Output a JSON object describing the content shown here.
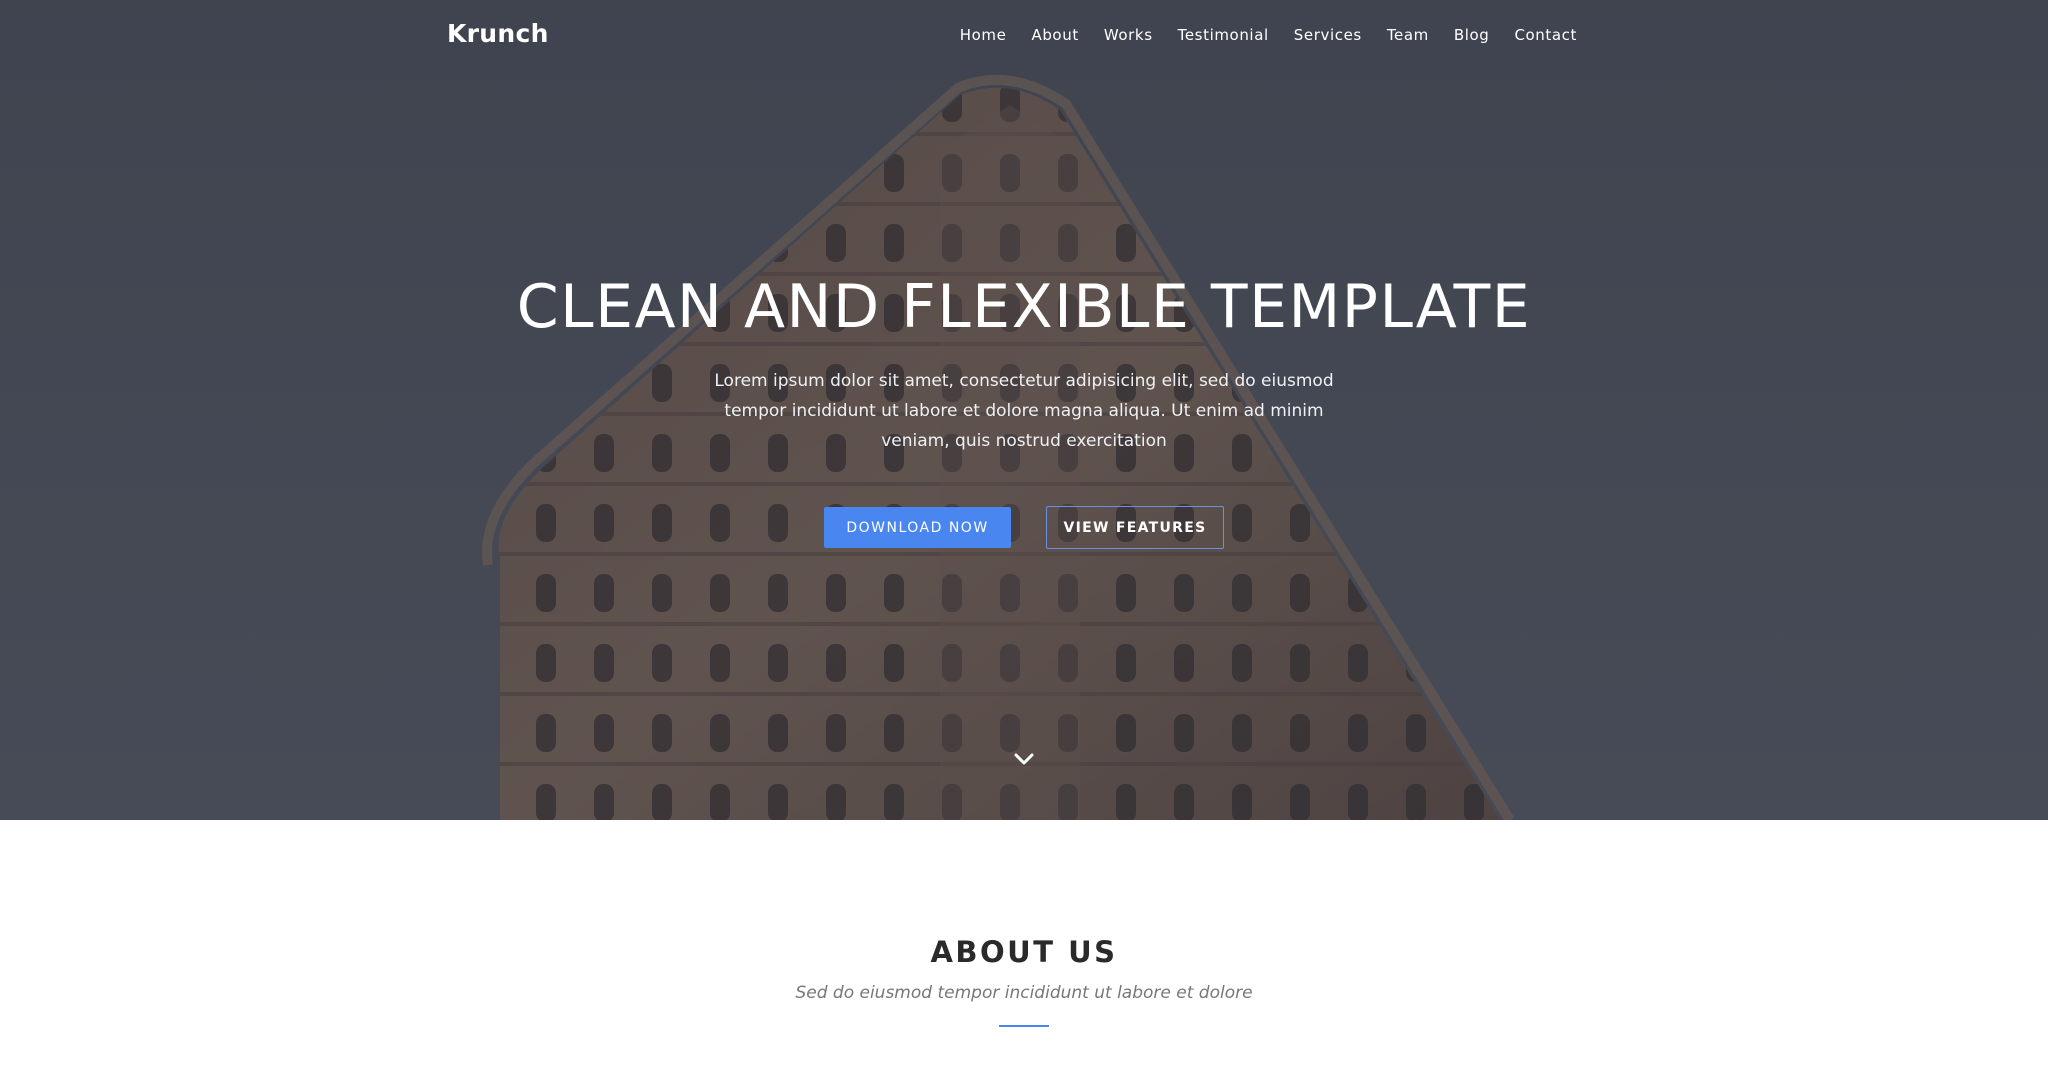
{
  "brand": {
    "name": "Krunch"
  },
  "nav": {
    "items": [
      {
        "label": "Home"
      },
      {
        "label": "About"
      },
      {
        "label": "Works"
      },
      {
        "label": "Testimonial"
      },
      {
        "label": "Services"
      },
      {
        "label": "Team"
      },
      {
        "label": "Blog"
      },
      {
        "label": "Contact"
      }
    ]
  },
  "hero": {
    "title": "CLEAN AND FLEXIBLE TEMPLATE",
    "text": "Lorem ipsum dolor sit amet, consectetur adipisicing elit, sed do eiusmod tempor incididunt ut labore et dolore magna aliqua. Ut enim ad minim veniam, quis nostrud exercitation",
    "primary_button": "DOWNLOAD NOW",
    "secondary_button": "VIEW FEATURES",
    "scroll_icon": "chevron-down-icon"
  },
  "about": {
    "title": "ABOUT US",
    "subtitle": "Sed do eiusmod tempor incididunt ut labore et dolore"
  },
  "colors": {
    "accent": "#4a86f0",
    "hero_overlay": "#2a2e38",
    "heading_dark": "#2a2a2a",
    "subtitle_gray": "#777777"
  }
}
